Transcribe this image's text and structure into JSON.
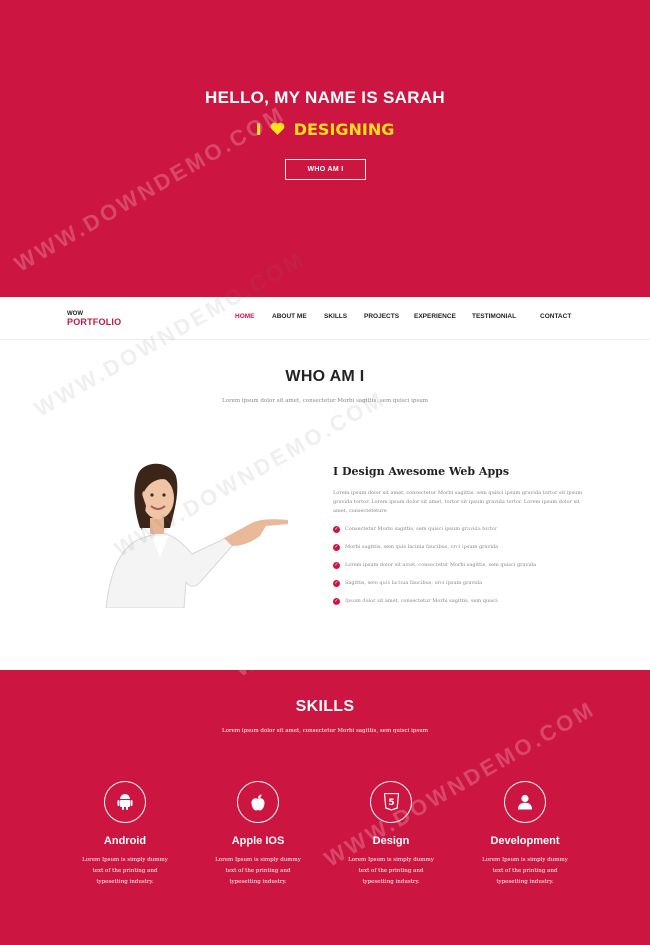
{
  "hero": {
    "title": "HELLO, MY NAME IS SARAH",
    "sub_before": "I",
    "sub_after": "DESIGNING",
    "button": "WHO AM I"
  },
  "nav": {
    "logo_small": "WOW",
    "logo_big": "PORTFOLIO",
    "items": [
      "HOME",
      "ABOUT ME",
      "SKILLS",
      "PROJECTS",
      "EXPERIENCE",
      "TESTIMONIAL",
      "CONTACT"
    ]
  },
  "who": {
    "title": "WHO AM I",
    "lead": "Lorem ipsum dolor sit amet, consectetur Morbi sagittis, sem quisci ipsum",
    "about_title": "I Design Awesome Web Apps",
    "about_para": "Lorem ipsum dolor sit amet, consectetur Morbi sagittis, sem quisci ipsum gravida tortor sit ipsum gravida tortor. Lorem ipsum dolor sit amet, tortor sit ipsum gravida tortor. Lorem ipsum dolor sit amet, consecteteture",
    "list": [
      "Consectetur Morbi sagittis, sem quisci ipsum gravida tortor",
      "Morbi sagittis, sem quis lacinia faucibus, orci ipsum gravida",
      "Lorem ipsum dolor sit amet, consectetur Morbi sagittis, sem quisci gravida",
      "Sagittis, sem quis lacinia faucibus, orci ipsum gravida",
      "Ipsum dolor sit amet, consectetur Morbi sagittis, sem quisci"
    ]
  },
  "skills": {
    "title": "SKILLS",
    "lead": "Lorem ipsum dolor sit amet, consectetur Morbi sagittis, sem quisci ipsum",
    "items": [
      {
        "name": "Android",
        "icon": "android-icon",
        "desc": "Lorem Ipsum is simply dummy\ntext of the printing and\ntypesetting industry."
      },
      {
        "name": "Apple IOS",
        "icon": "apple-icon",
        "desc": "Lorem Ipsum is simply dummy\ntext of the printing and\ntypesetting industry."
      },
      {
        "name": "Design",
        "icon": "html5-icon",
        "desc": "Lorem Ipsum is simply dummy\ntext of the printing and\ntypesetting industry."
      },
      {
        "name": "Development",
        "icon": "user-icon",
        "desc": "Lorem Ipsum is simply dummy\ntext of the printing and\ntypesetting industry."
      }
    ]
  },
  "watermark": "WWW.DOWNDEMO.COM",
  "colors": {
    "accent": "#cc1540",
    "highlight": "#ffe01a",
    "white": "#ffffff"
  }
}
